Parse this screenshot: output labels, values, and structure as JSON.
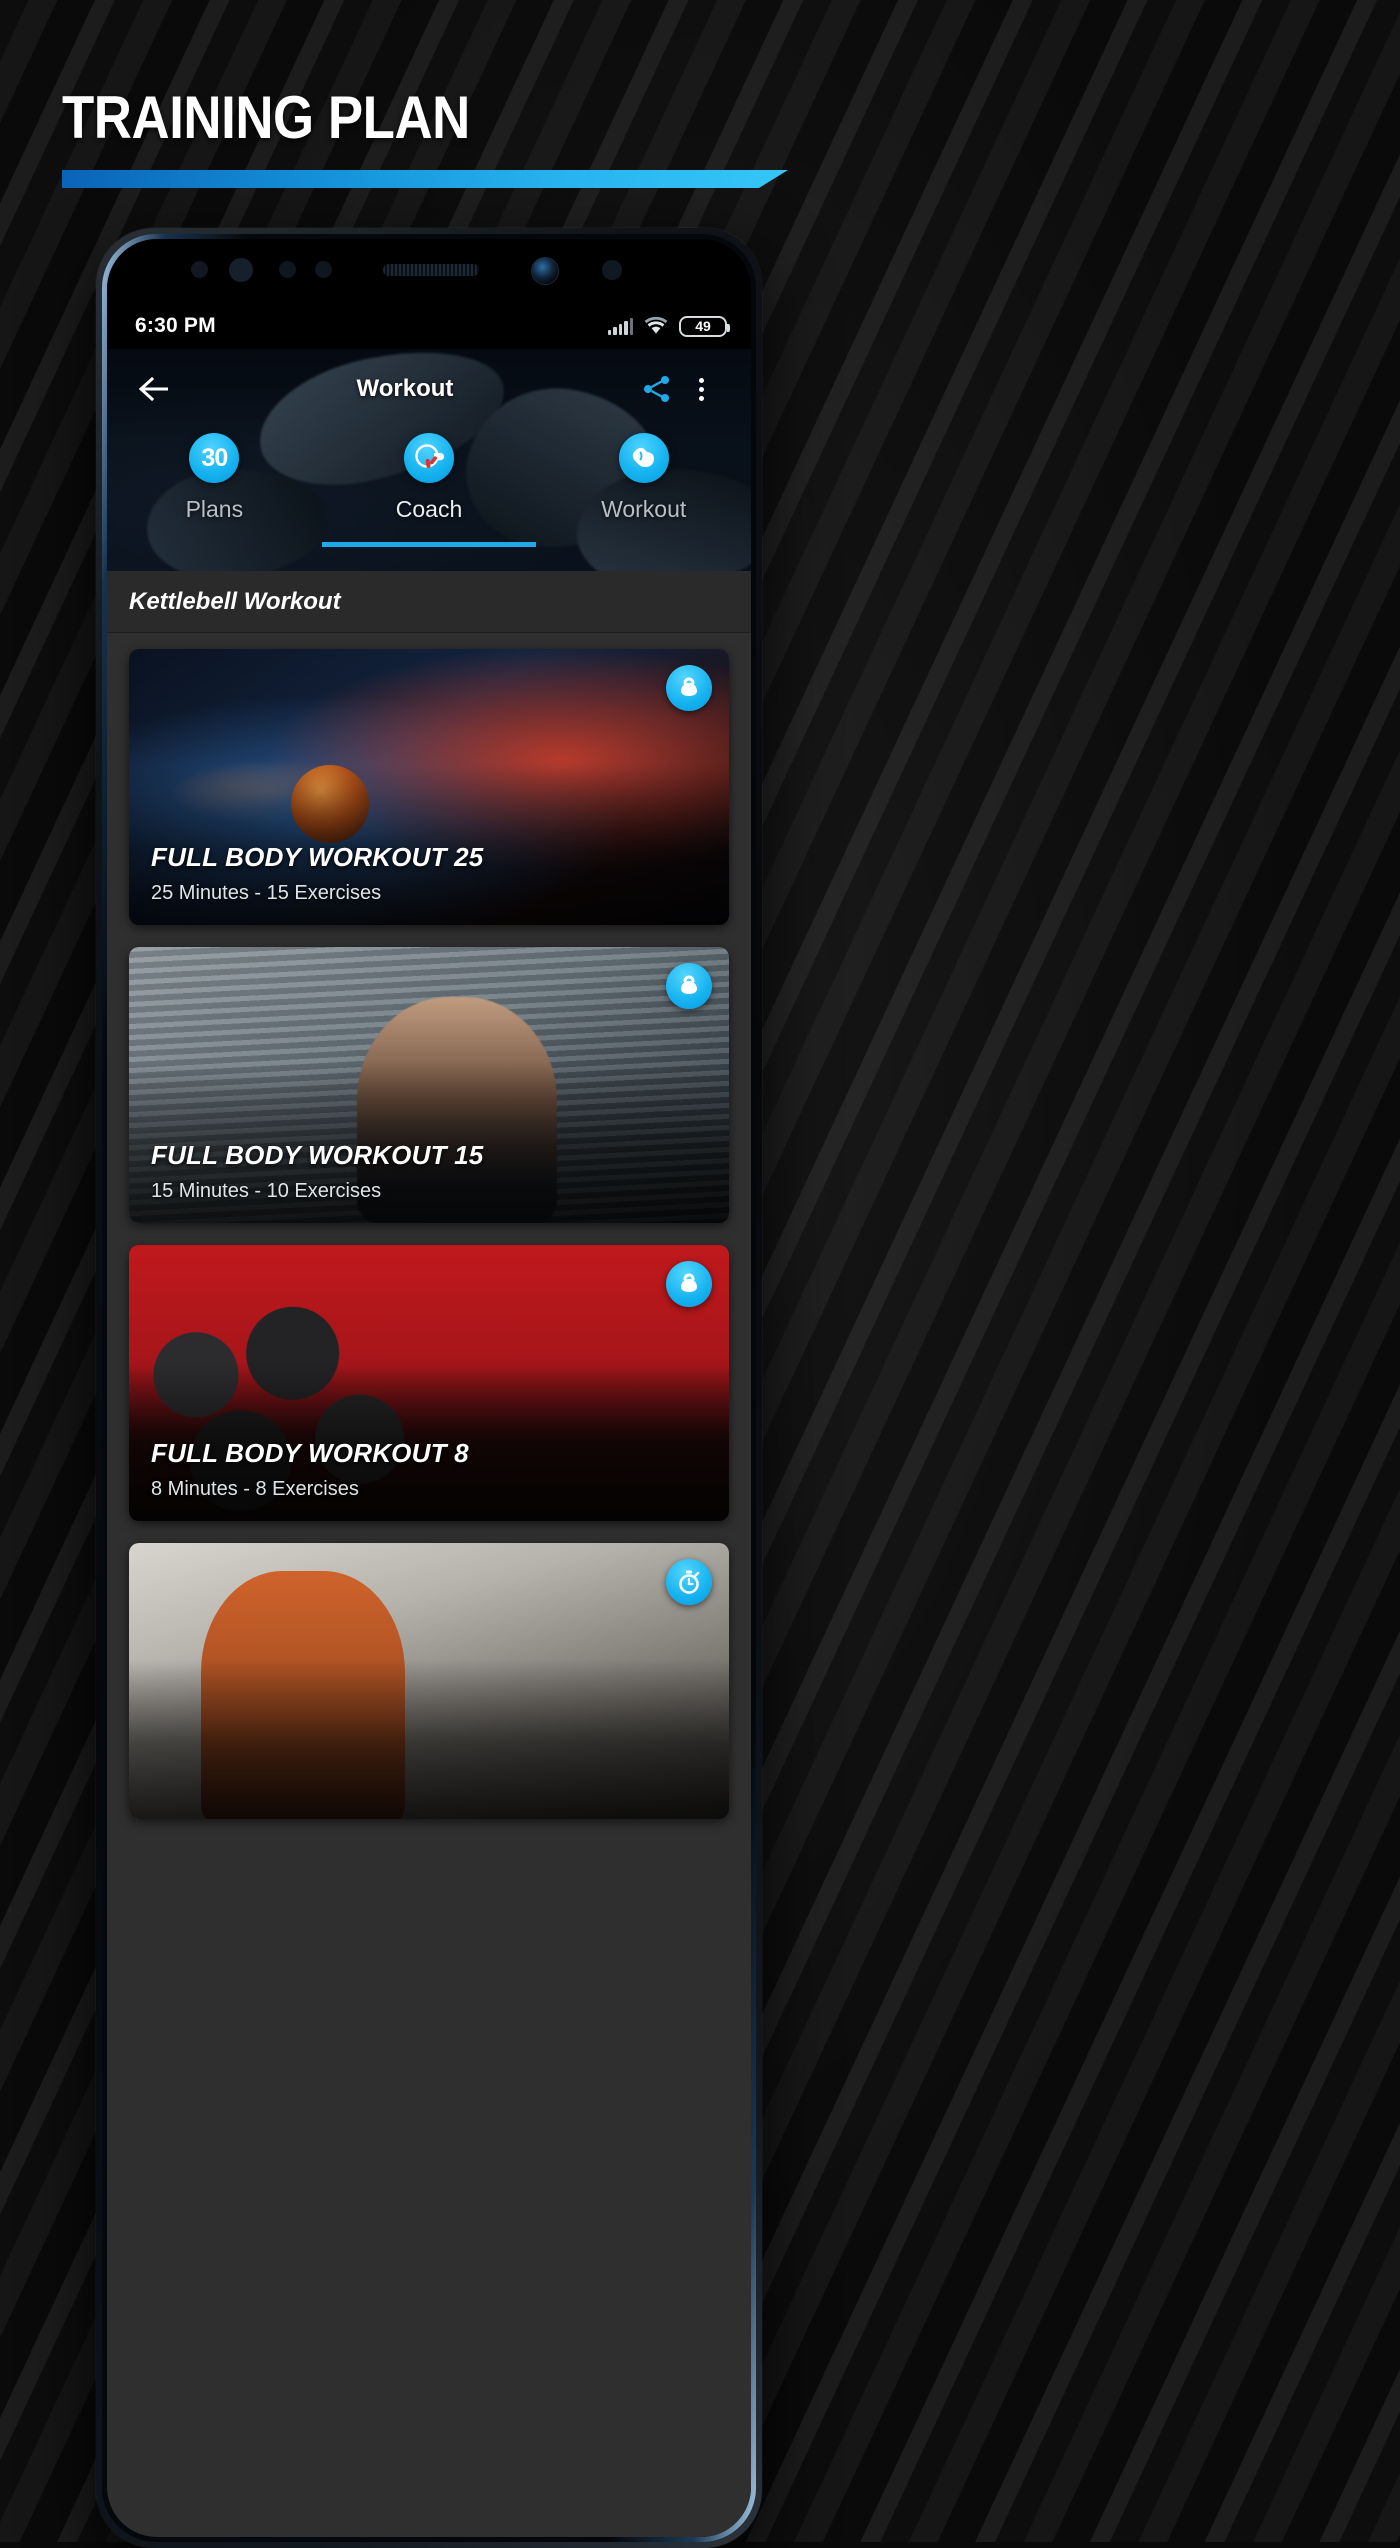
{
  "page": {
    "title": "TRAINING PLAN"
  },
  "phone": {
    "status_bar": {
      "time": "6:30 PM",
      "battery_level": "49",
      "signal_icon": "cellular-signal-icon",
      "wifi_icon": "wifi-icon",
      "battery_icon": "battery-icon"
    },
    "app_bar": {
      "back_icon": "back-arrow-icon",
      "title": "Workout",
      "share_icon": "share-icon",
      "overflow_icon": "more-vertical-icon"
    },
    "tabs": [
      {
        "label": "Plans",
        "icon": "calendar-30-icon",
        "badge_text": "30",
        "active": false
      },
      {
        "label": "Coach",
        "icon": "whistle-icon",
        "badge_text": "",
        "active": true
      },
      {
        "label": "Workout",
        "icon": "biceps-icon",
        "badge_text": "",
        "active": false
      }
    ],
    "section": {
      "heading": "Kettlebell Workout"
    },
    "workouts": [
      {
        "name": "FULL BODY WORKOUT 25",
        "meta": "25 Minutes - 15 Exercises",
        "badge_icon": "kettlebell-icon"
      },
      {
        "name": "FULL BODY WORKOUT 15",
        "meta": "15 Minutes - 10 Exercises",
        "badge_icon": "kettlebell-icon"
      },
      {
        "name": "FULL BODY WORKOUT 8",
        "meta": "8 Minutes - 8 Exercises",
        "badge_icon": "kettlebell-icon"
      },
      {
        "name": "",
        "meta": "",
        "badge_icon": "stopwatch-icon"
      }
    ]
  },
  "colors": {
    "accent": "#1fa9e8",
    "accent_light": "#4fd3ff",
    "background": "#0a0a0a",
    "list_background": "#2f2f2f",
    "section_background": "#2a2a2a",
    "text_primary": "#ffffff",
    "text_secondary": "#dfe4e8"
  }
}
